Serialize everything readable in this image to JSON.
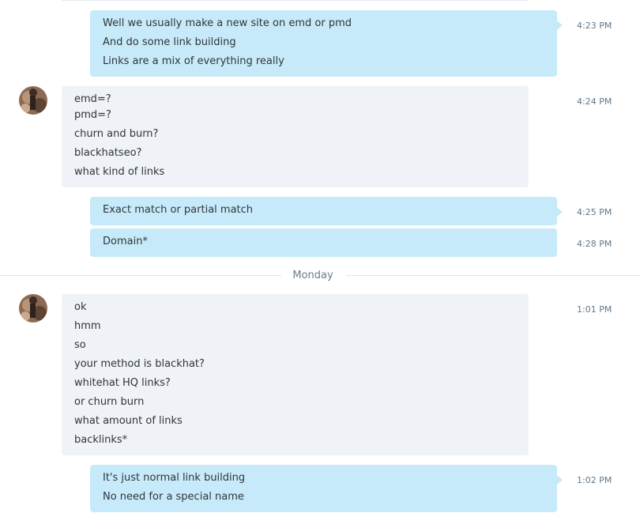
{
  "messages": [
    {
      "lines": [
        "Well we usually make a new site on emd or pmd",
        "And do some link building",
        "Links are a mix of everything really"
      ],
      "time": "4:23 PM"
    },
    {
      "lines": [
        "emd=?",
        "pmd=?",
        "churn and burn?",
        "blackhatseo?",
        "what kind of links"
      ],
      "time": "4:24 PM"
    },
    {
      "lines": [
        "Exact match or partial match"
      ],
      "time": "4:25 PM"
    },
    {
      "lines": [
        "Domain*"
      ],
      "time": "4:28 PM"
    },
    {
      "lines": [
        "ok",
        "hmm",
        "so",
        "your method is blackhat?",
        "whitehat HQ links?",
        "or churn burn",
        "what amount of links",
        "backlinks*"
      ],
      "time": "1:01 PM"
    },
    {
      "lines": [
        "It's just normal link building",
        "No need for a special name"
      ],
      "time": "1:02 PM"
    }
  ],
  "day_divider": "Monday",
  "colors": {
    "outgoing": "#c7eafa",
    "incoming": "#eff2f6",
    "timestamp": "#60788c"
  }
}
